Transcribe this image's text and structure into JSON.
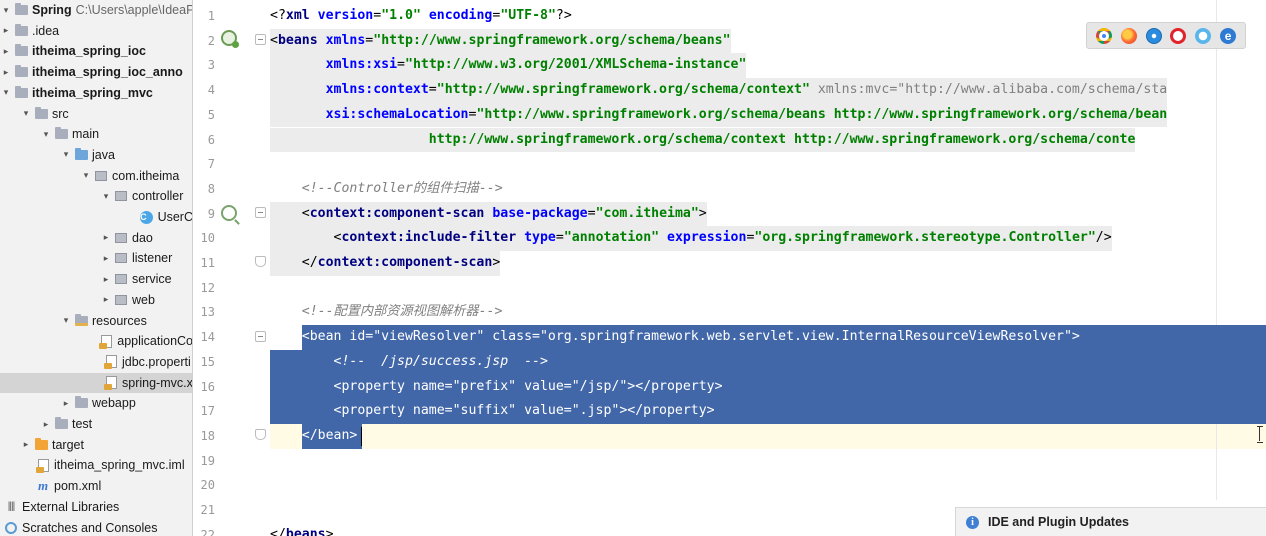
{
  "project_tree": {
    "items": [
      {
        "label": "Spring",
        "path": "C:\\Users\\apple\\IdeaPr",
        "icon": "project-folder-icon",
        "arrow": "▾"
      },
      {
        "label": ".idea",
        "icon": "folder-icon",
        "arrow": "▸"
      },
      {
        "label": "itheima_spring_ioc",
        "icon": "module-folder-icon",
        "arrow": "▸"
      },
      {
        "label": "itheima_spring_ioc_anno",
        "icon": "module-folder-icon",
        "arrow": "▸"
      },
      {
        "label": "itheima_spring_mvc",
        "icon": "module-folder-icon",
        "arrow": "▾"
      },
      {
        "label": "src",
        "icon": "folder-icon",
        "arrow": "▾"
      },
      {
        "label": "main",
        "icon": "folder-icon",
        "arrow": "▾"
      },
      {
        "label": "java",
        "icon": "source-folder-icon",
        "arrow": "▾"
      },
      {
        "label": "com.itheima",
        "icon": "package-icon",
        "arrow": "▾"
      },
      {
        "label": "controller",
        "icon": "package-icon",
        "arrow": "▾"
      },
      {
        "label": "UserC",
        "icon": "class-icon",
        "arrow": ""
      },
      {
        "label": "dao",
        "icon": "package-icon",
        "arrow": "▸"
      },
      {
        "label": "listener",
        "icon": "package-icon",
        "arrow": "▸"
      },
      {
        "label": "service",
        "icon": "package-icon",
        "arrow": "▸"
      },
      {
        "label": "web",
        "icon": "package-icon",
        "arrow": "▸"
      },
      {
        "label": "resources",
        "icon": "resources-folder-icon",
        "arrow": "▾"
      },
      {
        "label": "applicationCo",
        "icon": "xml-file-icon",
        "arrow": ""
      },
      {
        "label": "jdbc.properti",
        "icon": "properties-file-icon",
        "arrow": ""
      },
      {
        "label": "spring-mvc.x",
        "icon": "xml-file-icon",
        "arrow": ""
      },
      {
        "label": "webapp",
        "icon": "web-folder-icon",
        "arrow": "▸"
      },
      {
        "label": "test",
        "icon": "folder-icon",
        "arrow": "▸"
      },
      {
        "label": "target",
        "icon": "excluded-folder-icon",
        "arrow": "▸"
      },
      {
        "label": "itheima_spring_mvc.iml",
        "icon": "iml-file-icon",
        "arrow": ""
      },
      {
        "label": "pom.xml",
        "icon": "maven-icon",
        "arrow": ""
      },
      {
        "label": "External Libraries",
        "icon": "libraries-icon",
        "arrow": ""
      },
      {
        "label": "Scratches and Consoles",
        "icon": "scratches-icon",
        "arrow": ""
      }
    ]
  },
  "editor": {
    "line_numbers": [
      "1",
      "2",
      "3",
      "4",
      "5",
      "6",
      "7",
      "8",
      "9",
      "10",
      "11",
      "12",
      "13",
      "14",
      "15",
      "16",
      "17",
      "18",
      "19",
      "20",
      "21",
      "22"
    ],
    "lines": [
      [
        {
          "t": "<?",
          "c": "t-pi"
        },
        {
          "t": "xml ",
          "c": "t-tag"
        },
        {
          "t": "version",
          "c": "t-attr"
        },
        {
          "t": "=",
          "c": "t-br"
        },
        {
          "t": "\"1.0\"",
          "c": "t-str"
        },
        {
          "t": " encoding",
          "c": "t-attr"
        },
        {
          "t": "=",
          "c": "t-br"
        },
        {
          "t": "\"UTF-8\"",
          "c": "t-str"
        },
        {
          "t": "?>",
          "c": "t-pi"
        }
      ],
      [
        {
          "t": "<",
          "c": "t-br"
        },
        {
          "t": "beans ",
          "c": "t-tag"
        },
        {
          "t": "xmlns",
          "c": "t-attr"
        },
        {
          "t": "=",
          "c": "t-br"
        },
        {
          "t": "\"http://www.springframework.org/schema/beans\"",
          "c": "t-str"
        }
      ],
      [
        {
          "t": "       xmlns:xsi",
          "c": "t-attr"
        },
        {
          "t": "=",
          "c": "t-br"
        },
        {
          "t": "\"http://www.w3.org/2001/XMLSchema-instance\"",
          "c": "t-str"
        }
      ],
      [
        {
          "t": "       xmlns:context",
          "c": "t-attr"
        },
        {
          "t": "=",
          "c": "t-br"
        },
        {
          "t": "\"http://www.springframework.org/schema/context\"",
          "c": "t-str"
        },
        {
          "t": " xmlns:mvc=\"http://www.alibaba.com/schema/sta",
          "c": "t-dim"
        }
      ],
      [
        {
          "t": "       xsi:schemaLocation",
          "c": "t-attr"
        },
        {
          "t": "=",
          "c": "t-br"
        },
        {
          "t": "\"http://www.springframework.org/schema/beans http://www.springframework.org/schema/bean",
          "c": "t-str"
        }
      ],
      [
        {
          "t": "                    http://www.springframework.org/schema/context http://www.springframework.org/schema/conte",
          "c": "t-str"
        }
      ],
      [],
      [
        {
          "t": "    <!--Controller的组件扫描-->",
          "c": "t-com"
        }
      ],
      [
        {
          "t": "    <",
          "c": "t-br"
        },
        {
          "t": "context:component-scan ",
          "c": "t-tag"
        },
        {
          "t": "base-package",
          "c": "t-attr"
        },
        {
          "t": "=",
          "c": "t-br"
        },
        {
          "t": "\"com.itheima\"",
          "c": "t-str"
        },
        {
          "t": ">",
          "c": "t-br"
        }
      ],
      [
        {
          "t": "        <",
          "c": "t-br"
        },
        {
          "t": "context:include-filter ",
          "c": "t-tag"
        },
        {
          "t": "type",
          "c": "t-attr"
        },
        {
          "t": "=",
          "c": "t-br"
        },
        {
          "t": "\"annotation\"",
          "c": "t-str"
        },
        {
          "t": " expression",
          "c": "t-attr"
        },
        {
          "t": "=",
          "c": "t-br"
        },
        {
          "t": "\"org.springframework.stereotype.Controller\"",
          "c": "t-str"
        },
        {
          "t": "/>",
          "c": "t-br"
        }
      ],
      [
        {
          "t": "    </",
          "c": "t-br"
        },
        {
          "t": "context:component-scan",
          "c": "t-tag"
        },
        {
          "t": ">",
          "c": "t-br"
        }
      ],
      [],
      [
        {
          "t": "    <!--配置内部资源视图解析器-->",
          "c": "t-com"
        }
      ],
      [
        {
          "t": "    <bean id=\"viewResolver\" class=\"org.springframework.web.servlet.view.InternalResourceViewResolver\">",
          "c": "t-br"
        }
      ],
      [
        {
          "t": "        <!--  /jsp/success.jsp  -->",
          "c": "t-com"
        }
      ],
      [
        {
          "t": "        <property name=\"prefix\" value=\"/jsp/\"></property>",
          "c": "t-br"
        }
      ],
      [
        {
          "t": "        <property name=\"suffix\" value=\".jsp\"></property>",
          "c": "t-br"
        }
      ],
      [
        {
          "t": "    </bean>",
          "c": "t-br"
        }
      ],
      [],
      [],
      [],
      [
        {
          "t": "</",
          "c": "t-br"
        },
        {
          "t": "beans",
          "c": "t-tag"
        },
        {
          "t": ">",
          "c": "t-br"
        }
      ]
    ],
    "selected_line_indices": [
      13,
      14,
      15,
      16,
      17
    ],
    "current_line_index": 17,
    "highlighted_line_indices": [
      1,
      2,
      3,
      4,
      5,
      8,
      9,
      10
    ]
  },
  "browser_icons": [
    "chrome-icon",
    "firefox-icon",
    "safari-icon",
    "opera-icon",
    "ie-icon",
    "edge-icon"
  ],
  "notification": {
    "title": "IDE and Plugin Updates",
    "icon": "info-icon"
  },
  "colors": {
    "selection": "#4267a8",
    "tag": "#000080",
    "attribute": "#0000ff",
    "string": "#008000",
    "comment": "#808080"
  }
}
